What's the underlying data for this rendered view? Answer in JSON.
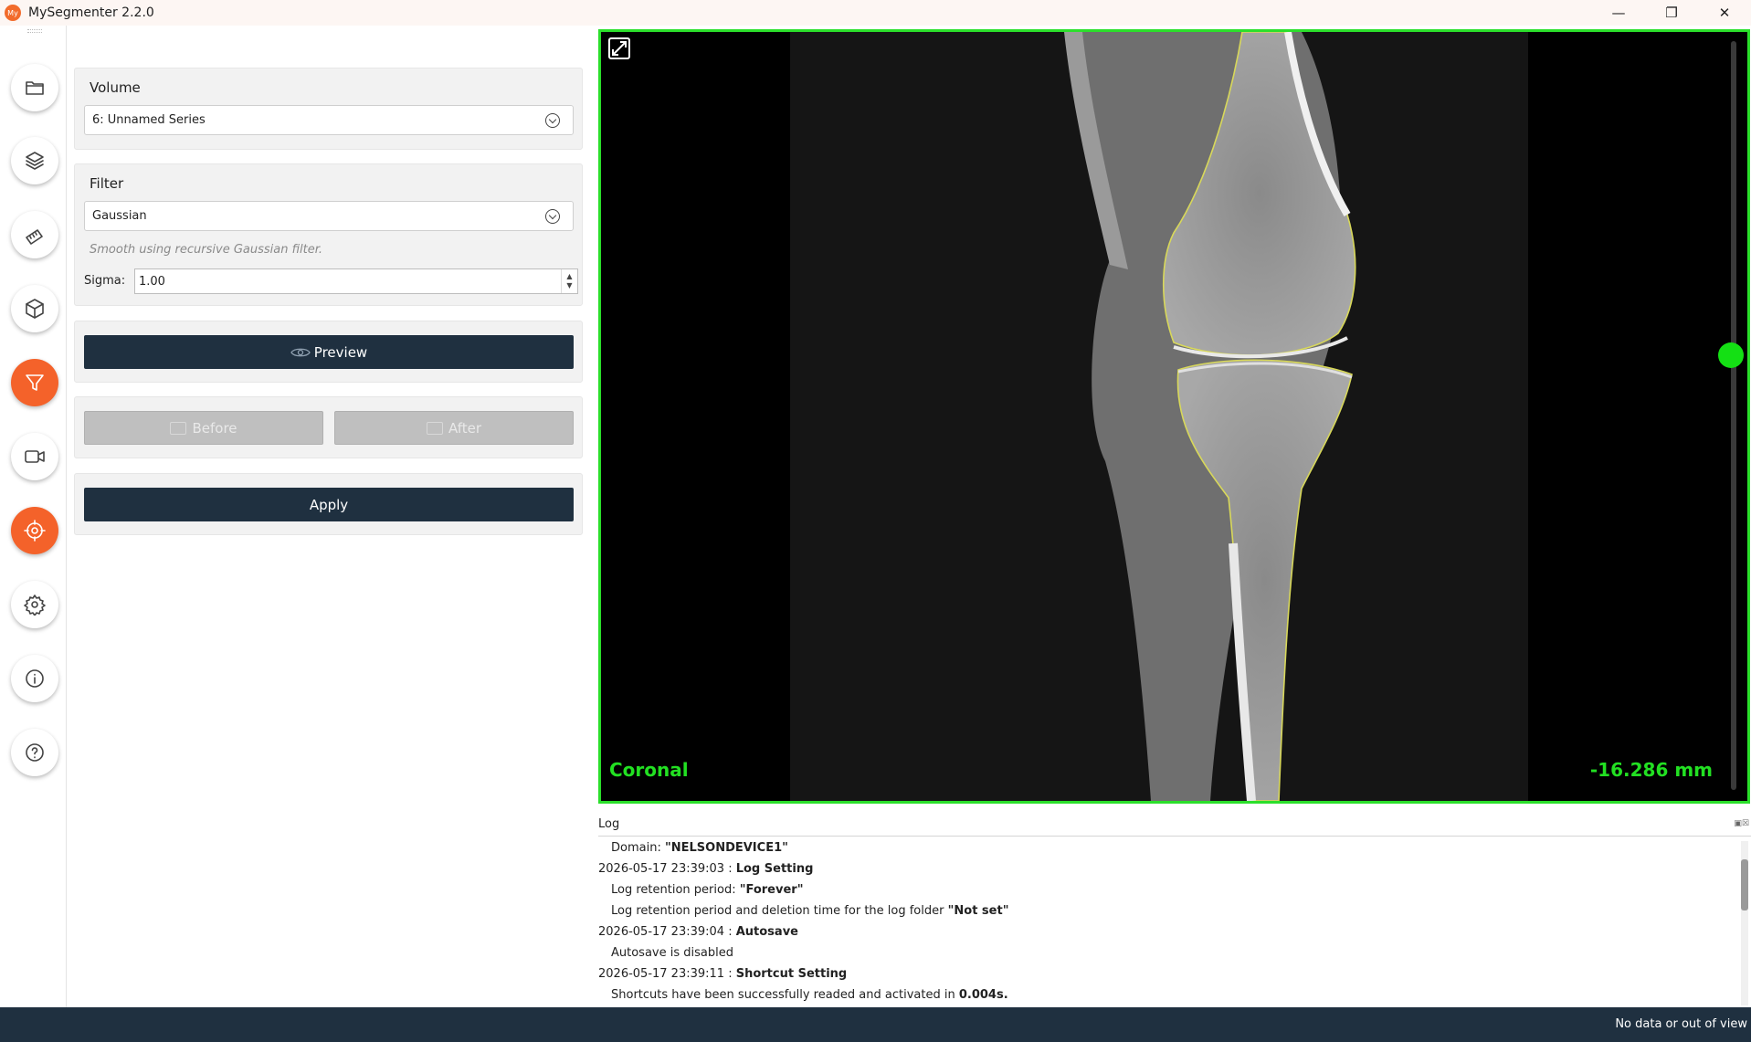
{
  "window": {
    "title": "MySegmenter 2.2.0",
    "logo_text": "My",
    "controls": [
      "minimize",
      "restore",
      "close"
    ]
  },
  "rail": {
    "items": [
      {
        "icon": "folder-icon",
        "active": false
      },
      {
        "icon": "layers-icon",
        "active": false
      },
      {
        "icon": "ruler-icon",
        "active": false
      },
      {
        "icon": "cube-icon",
        "active": false
      },
      {
        "icon": "filter-icon",
        "active": true
      },
      {
        "icon": "video-icon",
        "active": false
      },
      {
        "icon": "target-icon",
        "active": true
      },
      {
        "icon": "gear-icon",
        "active": false
      },
      {
        "icon": "info-icon",
        "active": false
      },
      {
        "icon": "help-icon",
        "active": false
      }
    ],
    "active_color": "#f4622a"
  },
  "volume": {
    "title": "Volume",
    "selected": "6: Unnamed Series"
  },
  "filter": {
    "title": "Filter",
    "selected": "Gaussian",
    "description": "Smooth using recursive Gaussian filter.",
    "sigma_label": "Sigma:",
    "sigma_value": "1.00"
  },
  "actions": {
    "preview_label": "Preview",
    "before_label": "Before",
    "after_label": "After",
    "apply_label": "Apply",
    "button_color": "#1f3040"
  },
  "viewer": {
    "view_name": "Coronal",
    "position": "-16.286 mm",
    "border_color": "#2bdf2b",
    "slice_position": 0.42
  },
  "log": {
    "title": "Log",
    "lines": [
      {
        "prefix": "Domain: ",
        "bold": "\"NELSONDEVICE1\"",
        "suffix": "",
        "indent": true
      },
      {
        "prefix": "2026-05-17 23:39:03 : ",
        "bold": "Log Setting",
        "suffix": "",
        "indent": false
      },
      {
        "prefix": "Log retention period: ",
        "bold": "\"Forever\"",
        "suffix": "",
        "indent": true
      },
      {
        "prefix": "Log retention period and deletion time for the log folder ",
        "bold": "\"Not set\"",
        "suffix": "",
        "indent": true
      },
      {
        "prefix": "2026-05-17 23:39:04 : ",
        "bold": "Autosave",
        "suffix": "",
        "indent": false
      },
      {
        "prefix": "Autosave is disabled",
        "bold": "",
        "suffix": "",
        "indent": true
      },
      {
        "prefix": "2026-05-17 23:39:11 : ",
        "bold": "Shortcut Setting",
        "suffix": "",
        "indent": false
      },
      {
        "prefix": "Shortcuts have been successfully readed and activated in ",
        "bold": "0.004s.",
        "suffix": "",
        "indent": true
      }
    ]
  },
  "status": {
    "text": "No data or out of view"
  }
}
